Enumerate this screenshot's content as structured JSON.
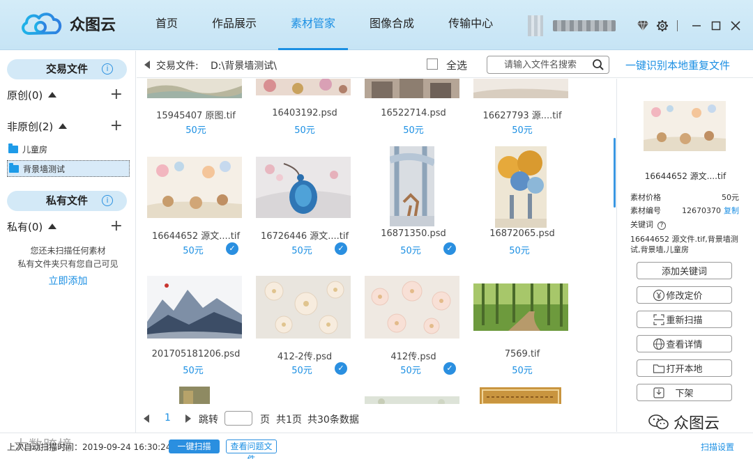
{
  "app": {
    "name": "众图云"
  },
  "nav": [
    {
      "label": "首页",
      "active": false
    },
    {
      "label": "作品展示",
      "active": false
    },
    {
      "label": "素材管家",
      "active": true
    },
    {
      "label": "图像合成",
      "active": false
    },
    {
      "label": "传输中心",
      "active": false
    }
  ],
  "header_icons": [
    "diamond-icon",
    "gear-icon",
    "minimize-icon",
    "maximize-icon",
    "close-icon"
  ],
  "sidebar": {
    "trade_label": "交易文件",
    "original": {
      "label": "原创(0)"
    },
    "non_original": {
      "label": "非原创(2)"
    },
    "folders": [
      {
        "label": "儿童房",
        "selected": false
      },
      {
        "label": "背景墙测试",
        "selected": true
      }
    ],
    "private_label": "私有文件",
    "private": {
      "label": "私有(0)"
    },
    "empty_line1": "您还未扫描任何素材",
    "empty_line2": "私有文件夹只有您自己可见",
    "add_link": "立即添加"
  },
  "toolbar": {
    "path_label": "交易文件:",
    "path_value": "D:\\背景墙测试\\",
    "select_all": "全选",
    "search_placeholder": "请输入文件名搜索",
    "dup_link": "一键识别本地重复文件"
  },
  "grid": {
    "items": [
      {
        "name": "15945407 原图.tif",
        "price": "50元",
        "checked": false
      },
      {
        "name": "16403192.psd",
        "price": "50元",
        "checked": false
      },
      {
        "name": "16522714.psd",
        "price": "50元",
        "checked": false
      },
      {
        "name": "16627793 源....tif",
        "price": "50元",
        "checked": false
      },
      {
        "name": "16644652 源文....tif",
        "price": "50元",
        "checked": true
      },
      {
        "name": "16726446 源文....tif",
        "price": "50元",
        "checked": true
      },
      {
        "name": "16871350.psd",
        "price": "50元",
        "checked": true
      },
      {
        "name": "16872065.psd",
        "price": "50元",
        "checked": false
      },
      {
        "name": "201705181206.psd",
        "price": "50元",
        "checked": false
      },
      {
        "name": "412-2传.psd",
        "price": "50元",
        "checked": true
      },
      {
        "name": "412传.psd",
        "price": "50元",
        "checked": true
      },
      {
        "name": "7569.tif",
        "price": "50元",
        "checked": false
      }
    ],
    "check_glyph": "✓"
  },
  "pager": {
    "current": "1",
    "jump": "跳转",
    "unit": "页",
    "total": "共1页",
    "count": "共30条数据"
  },
  "detail": {
    "name": "16644652 源文....tif",
    "price_label": "素材价格",
    "price_value": "50元",
    "code_label": "素材编号",
    "code_value": "12670370",
    "copy": "复制",
    "keyword_label": "关键词",
    "help_glyph": "?",
    "tags": "16644652 源文件.tif,背景墙测试,背景墙,儿童房",
    "buttons": [
      {
        "label": "添加关键词"
      },
      {
        "label": "修改定价"
      },
      {
        "label": "重新扫描"
      },
      {
        "label": "查看详情"
      },
      {
        "label": "打开本地"
      },
      {
        "label": "下架"
      }
    ]
  },
  "status": {
    "text": "上次自动扫描时间：2019-09-24 16:30:24",
    "scan_btn": "一键扫描",
    "issue_btn": "查看问题文件",
    "settings": "扫描设置"
  },
  "watermark": {
    "right": "众图云",
    "left": "大数跨境"
  }
}
